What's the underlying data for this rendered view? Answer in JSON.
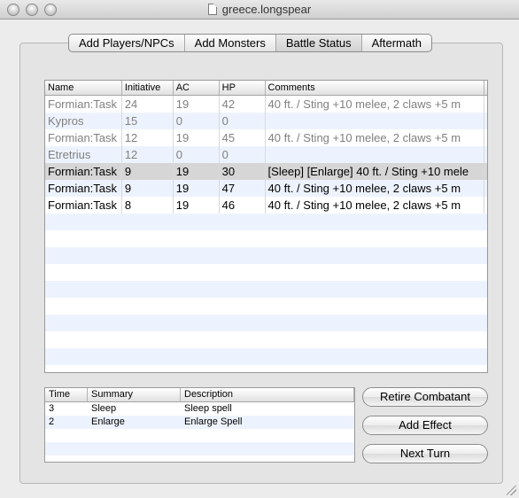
{
  "window": {
    "title": "greece.longspear"
  },
  "tabs": [
    {
      "label": "Add Players/NPCs",
      "selected": false
    },
    {
      "label": "Add Monsters",
      "selected": false
    },
    {
      "label": "Battle Status",
      "selected": true
    },
    {
      "label": "Aftermath",
      "selected": false
    }
  ],
  "combatants": {
    "columns": [
      "Name",
      "Initiative",
      "AC",
      "HP",
      "Comments"
    ],
    "rows": [
      {
        "name": "Formian:Task",
        "initiative": "24",
        "ac": "19",
        "hp": "42",
        "comments": "40 ft. / Sting +10 melee, 2 claws +5 m",
        "style": "dim"
      },
      {
        "name": "Kypros",
        "initiative": "15",
        "ac": "0",
        "hp": "0",
        "comments": "",
        "style": "dim"
      },
      {
        "name": "Formian:Task",
        "initiative": "12",
        "ac": "19",
        "hp": "45",
        "comments": "40 ft. / Sting +10 melee, 2 claws +5 m",
        "style": "dim"
      },
      {
        "name": "Etretrius",
        "initiative": "12",
        "ac": "0",
        "hp": "0",
        "comments": "",
        "style": "dim"
      },
      {
        "name": "Formian:Task",
        "initiative": "9",
        "ac": "19",
        "hp": "30",
        "comments": "[Sleep] [Enlarge] 40 ft. / Sting +10 mele",
        "style": "selected"
      },
      {
        "name": "Formian:Task",
        "initiative": "9",
        "ac": "19",
        "hp": "47",
        "comments": "40 ft. / Sting +10 melee, 2 claws +5 m",
        "style": "dark"
      },
      {
        "name": "Formian:Task",
        "initiative": "8",
        "ac": "19",
        "hp": "46",
        "comments": "40 ft. / Sting +10 melee, 2 claws +5 m",
        "style": "dark"
      }
    ]
  },
  "effects": {
    "columns": [
      "Time",
      "Summary",
      "Description"
    ],
    "rows": [
      {
        "time": "3",
        "summary": "Sleep",
        "description": "Sleep spell"
      },
      {
        "time": "2",
        "summary": "Enlarge",
        "description": "Enlarge Spell"
      }
    ]
  },
  "buttons": {
    "retire": "Retire Combatant",
    "add_effect": "Add Effect",
    "next_turn": "Next Turn"
  }
}
